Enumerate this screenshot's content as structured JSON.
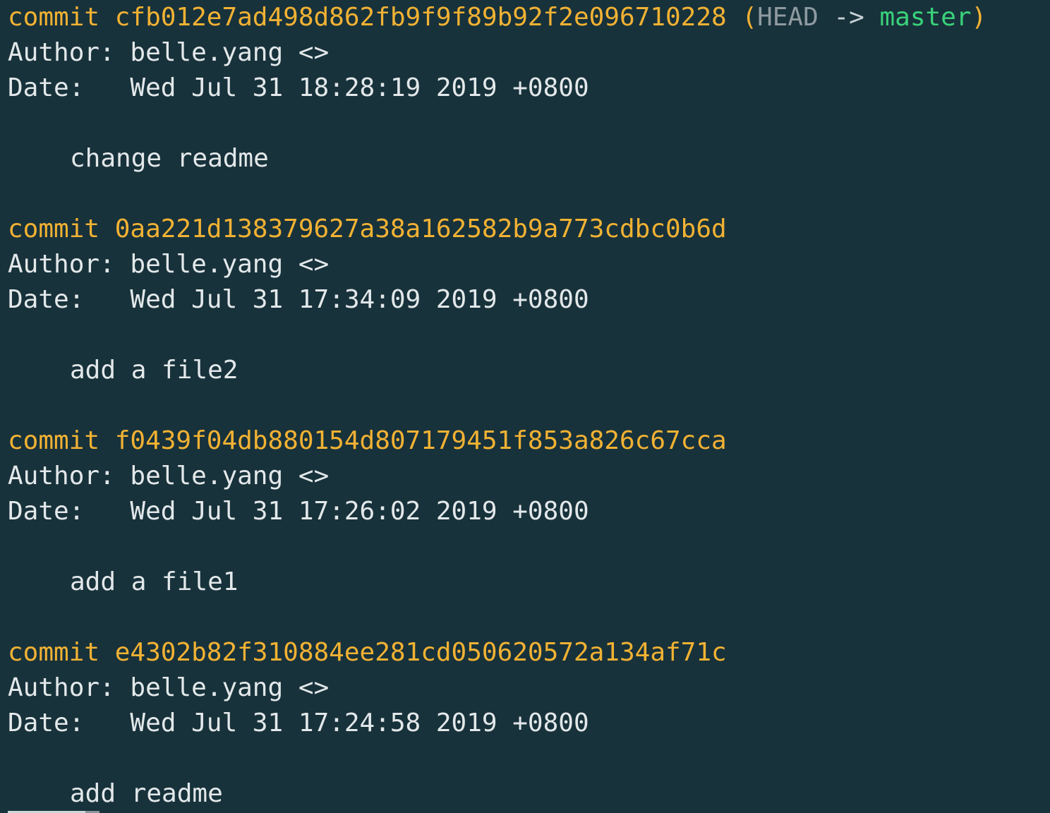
{
  "terminal": {
    "commits": [
      {
        "keyword": "commit",
        "hash": "cfb012e7ad498d862fb9f9f89b92f2e096710228",
        "ref_open": "(",
        "ref_head": "HEAD",
        "ref_arrow": "->",
        "ref_branch": "master",
        "ref_close": ")",
        "author_label": "Author:",
        "author_value": "belle.yang <>",
        "date_label": "Date:",
        "date_value": "Wed Jul 31 18:28:19 2019 +0800",
        "message": "change readme"
      },
      {
        "keyword": "commit",
        "hash": "0aa221d138379627a38a162582b9a773cdbc0b6d",
        "author_label": "Author:",
        "author_value": "belle.yang <>",
        "date_label": "Date:",
        "date_value": "Wed Jul 31 17:34:09 2019 +0800",
        "message": "add a file2"
      },
      {
        "keyword": "commit",
        "hash": "f0439f04db880154d807179451f853a826c67cca",
        "author_label": "Author:",
        "author_value": "belle.yang <>",
        "date_label": "Date:",
        "date_value": "Wed Jul 31 17:26:02 2019 +0800",
        "message": "add a file1"
      },
      {
        "keyword": "commit",
        "hash": "e4302b82f310884ee281cd050620572a134af71c",
        "author_label": "Author:",
        "author_value": "belle.yang <>",
        "date_label": "Date:",
        "date_value": "Wed Jul 31 17:24:58 2019 +0800",
        "message": "add readme"
      }
    ]
  },
  "colors": {
    "background": "#18323b",
    "commit_hash": "#f2b233",
    "head": "#8e9aa0",
    "branch": "#3ad27a",
    "text": "#e3e8ea"
  }
}
